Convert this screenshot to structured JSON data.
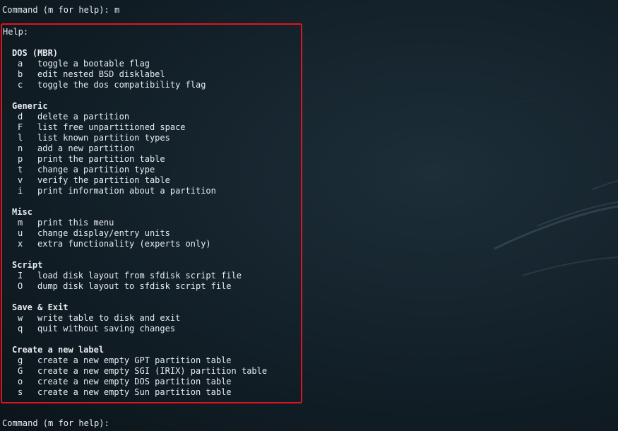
{
  "terminal": {
    "prompt_top": "Command (m for help): m",
    "prompt_bottom": "Command (m for help):",
    "help_title": "Help:"
  },
  "sections": [
    {
      "title": "DOS (MBR)",
      "items": [
        {
          "key": "a",
          "desc": "toggle a bootable flag"
        },
        {
          "key": "b",
          "desc": "edit nested BSD disklabel"
        },
        {
          "key": "c",
          "desc": "toggle the dos compatibility flag"
        }
      ]
    },
    {
      "title": "Generic",
      "items": [
        {
          "key": "d",
          "desc": "delete a partition"
        },
        {
          "key": "F",
          "desc": "list free unpartitioned space"
        },
        {
          "key": "l",
          "desc": "list known partition types"
        },
        {
          "key": "n",
          "desc": "add a new partition"
        },
        {
          "key": "p",
          "desc": "print the partition table"
        },
        {
          "key": "t",
          "desc": "change a partition type"
        },
        {
          "key": "v",
          "desc": "verify the partition table"
        },
        {
          "key": "i",
          "desc": "print information about a partition"
        }
      ]
    },
    {
      "title": "Misc",
      "items": [
        {
          "key": "m",
          "desc": "print this menu"
        },
        {
          "key": "u",
          "desc": "change display/entry units"
        },
        {
          "key": "x",
          "desc": "extra functionality (experts only)"
        }
      ]
    },
    {
      "title": "Script",
      "items": [
        {
          "key": "I",
          "desc": "load disk layout from sfdisk script file"
        },
        {
          "key": "O",
          "desc": "dump disk layout to sfdisk script file"
        }
      ]
    },
    {
      "title": "Save & Exit",
      "items": [
        {
          "key": "w",
          "desc": "write table to disk and exit"
        },
        {
          "key": "q",
          "desc": "quit without saving changes"
        }
      ]
    },
    {
      "title": "Create a new label",
      "items": [
        {
          "key": "g",
          "desc": "create a new empty GPT partition table"
        },
        {
          "key": "G",
          "desc": "create a new empty SGI (IRIX) partition table"
        },
        {
          "key": "o",
          "desc": "create a new empty DOS partition table"
        },
        {
          "key": "s",
          "desc": "create a new empty Sun partition table"
        }
      ]
    }
  ],
  "colors": {
    "highlight_border": "#e0141e",
    "background": "#14222b",
    "text": "#e8ecef"
  }
}
